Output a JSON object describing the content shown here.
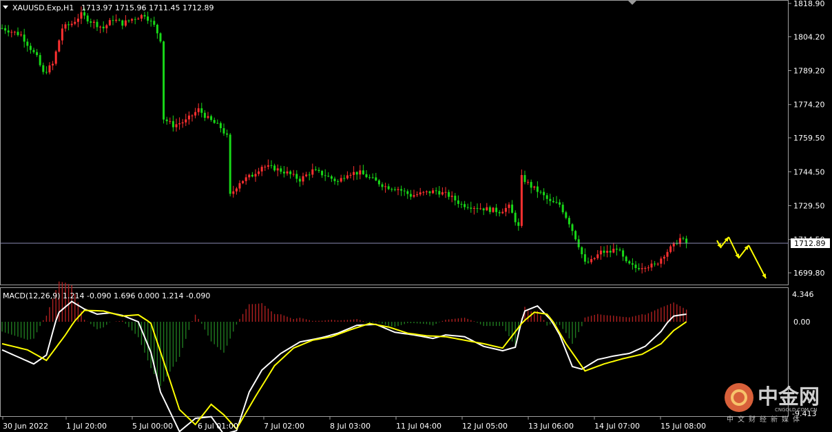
{
  "header": {
    "symbol": "XAUUSD.Exp,H1",
    "ohlc": "1713.97 1715.96 1711.45 1712.89"
  },
  "macd": {
    "label": "MACD(12,26,9) 1.214 -0.090 1.696 0.000 1.214 -0.090",
    "top_label": "4.346",
    "zero_label": "0.00",
    "bottom_label": "-9.413"
  },
  "watermark": {
    "brand": "中金网",
    "tagline": "中文财经新媒体",
    "url": "CNGOLD.COM.CN"
  },
  "colors": {
    "background": "#000000",
    "bull": "#ff3030",
    "bear": "#18d818",
    "macd_line": "#ffffff",
    "signal_line": "#ffff00",
    "arrow": "#ffff00",
    "price_line": "#8c8cb4"
  },
  "chart_data": [
    {
      "type": "candlestick",
      "symbol": "XAUUSD.Exp",
      "timeframe": "H1",
      "current_price": 1712.89,
      "current_price_label": "1712.89",
      "ylim": [
        1693.0,
        1820.0
      ],
      "y_ticks": [
        "1818.90",
        "1804.20",
        "1789.20",
        "1774.20",
        "1759.50",
        "1744.50",
        "1729.50",
        "1714.50",
        "1699.80"
      ],
      "x_ticks": [
        "30 Jun 2022",
        "1 Jul 20:00",
        "5 Jul 00:00",
        "6 Jul 01:00",
        "7 Jul 02:00",
        "8 Jul 03:00",
        "11 Jul 04:00",
        "12 Jul 05:00",
        "13 Jul 06:00",
        "14 Jul 07:00",
        "15 Jul 08:00"
      ],
      "close_path": [
        [
          0,
          1808
        ],
        [
          6,
          1805
        ],
        [
          11,
          1795
        ],
        [
          13,
          1788
        ],
        [
          16,
          1792
        ],
        [
          19,
          1808
        ],
        [
          22,
          1810
        ],
        [
          25,
          1814
        ],
        [
          28,
          1811
        ],
        [
          32,
          1808
        ],
        [
          35,
          1812
        ],
        [
          38,
          1810
        ],
        [
          41,
          1812
        ],
        [
          45,
          1814
        ],
        [
          48,
          1809
        ],
        [
          50,
          1803
        ],
        [
          51,
          1768
        ],
        [
          54,
          1765
        ],
        [
          58,
          1767
        ],
        [
          62,
          1772
        ],
        [
          65,
          1768
        ],
        [
          69,
          1764
        ],
        [
          71,
          1760
        ],
        [
          72,
          1734
        ],
        [
          75,
          1740
        ],
        [
          79,
          1743
        ],
        [
          82,
          1747
        ],
        [
          86,
          1746
        ],
        [
          90,
          1744
        ],
        [
          94,
          1741
        ],
        [
          98,
          1745
        ],
        [
          102,
          1743
        ],
        [
          106,
          1740
        ],
        [
          109,
          1744
        ],
        [
          113,
          1744
        ],
        [
          117,
          1741
        ],
        [
          121,
          1738
        ],
        [
          125,
          1737
        ],
        [
          129,
          1734
        ],
        [
          133,
          1735
        ],
        [
          137,
          1736
        ],
        [
          141,
          1734
        ],
        [
          145,
          1730
        ],
        [
          149,
          1729
        ],
        [
          153,
          1728
        ],
        [
          157,
          1727
        ],
        [
          160,
          1729
        ],
        [
          163,
          1720
        ],
        [
          164,
          1742
        ],
        [
          167,
          1738
        ],
        [
          170,
          1735
        ],
        [
          173,
          1731
        ],
        [
          176,
          1730
        ],
        [
          179,
          1722
        ],
        [
          182,
          1712
        ],
        [
          184,
          1704
        ],
        [
          186,
          1705
        ],
        [
          189,
          1709
        ],
        [
          192,
          1709
        ],
        [
          194,
          1711
        ],
        [
          197,
          1704
        ],
        [
          200,
          1702
        ],
        [
          203,
          1703
        ],
        [
          206,
          1703
        ],
        [
          209,
          1708
        ],
        [
          212,
          1712
        ],
        [
          214,
          1715
        ],
        [
          216,
          1713
        ]
      ],
      "macd_close_path": [
        [
          0,
          -3.2
        ],
        [
          10,
          -4.8
        ],
        [
          14,
          -3.8
        ],
        [
          18,
          1.5
        ],
        [
          22,
          3.2
        ],
        [
          26,
          2.0
        ],
        [
          30,
          1.2
        ],
        [
          34,
          1.4
        ],
        [
          38,
          1.0
        ],
        [
          43,
          0.0
        ],
        [
          47,
          -3.5
        ],
        [
          50,
          -8.0
        ],
        [
          56,
          -12.5
        ],
        [
          61,
          -11.0
        ],
        [
          66,
          -10.8
        ],
        [
          70,
          -12.8
        ],
        [
          74,
          -12.4
        ],
        [
          78,
          -8.0
        ],
        [
          82,
          -5.5
        ],
        [
          88,
          -3.6
        ],
        [
          94,
          -2.3
        ],
        [
          101,
          -1.8
        ],
        [
          106,
          -1.3
        ],
        [
          112,
          -0.4
        ],
        [
          118,
          -0.3
        ],
        [
          124,
          -1.2
        ],
        [
          130,
          -1.5
        ],
        [
          136,
          -1.9
        ],
        [
          140,
          -1.5
        ],
        [
          146,
          -1.7
        ],
        [
          152,
          -2.8
        ],
        [
          158,
          -3.3
        ],
        [
          162,
          -2.9
        ],
        [
          165,
          1.7
        ],
        [
          169,
          2.5
        ],
        [
          173,
          0.4
        ],
        [
          176,
          -1.5
        ],
        [
          180,
          -5.1
        ],
        [
          183,
          -5.4
        ],
        [
          188,
          -4.3
        ],
        [
          193,
          -3.9
        ],
        [
          198,
          -3.6
        ],
        [
          203,
          -2.8
        ],
        [
          208,
          -1.1
        ],
        [
          212,
          0.9
        ],
        [
          216,
          1.2
        ]
      ],
      "macd_signal_path": [
        [
          0,
          -2.5
        ],
        [
          8,
          -3.2
        ],
        [
          14,
          -4.4
        ],
        [
          20,
          -1.5
        ],
        [
          26,
          1.8
        ],
        [
          32,
          1.7
        ],
        [
          38,
          0.9
        ],
        [
          43,
          1.1
        ],
        [
          47,
          -0.2
        ],
        [
          51,
          -4.5
        ],
        [
          56,
          -10.0
        ],
        [
          61,
          -11.7
        ],
        [
          66,
          -9.4
        ],
        [
          70,
          -10.6
        ],
        [
          74,
          -12.2
        ],
        [
          80,
          -8.5
        ],
        [
          86,
          -5.0
        ],
        [
          92,
          -3.0
        ],
        [
          98,
          -2.1
        ],
        [
          104,
          -1.7
        ],
        [
          110,
          -0.9
        ],
        [
          116,
          -0.2
        ],
        [
          122,
          -0.6
        ],
        [
          128,
          -1.3
        ],
        [
          134,
          -1.6
        ],
        [
          140,
          -1.7
        ],
        [
          146,
          -2.1
        ],
        [
          152,
          -2.5
        ],
        [
          158,
          -3.0
        ],
        [
          164,
          -0.2
        ],
        [
          168,
          1.5
        ],
        [
          172,
          1.2
        ],
        [
          178,
          -2.5
        ],
        [
          184,
          -5.6
        ],
        [
          190,
          -4.8
        ],
        [
          196,
          -4.2
        ],
        [
          202,
          -3.7
        ],
        [
          208,
          -2.5
        ],
        [
          212,
          -1.0
        ],
        [
          216,
          0.0
        ]
      ],
      "forecast_arrows": [
        [
          [
            1041,
            349
          ],
          [
            1047,
            360
          ]
        ],
        [
          [
            1047,
            358
          ],
          [
            1058,
            344
          ]
        ],
        [
          [
            1058,
            344
          ],
          [
            1073,
            375
          ]
        ],
        [
          [
            1073,
            374
          ],
          [
            1087,
            356
          ]
        ],
        [
          [
            1087,
            356
          ],
          [
            1112,
            404
          ]
        ]
      ]
    }
  ]
}
